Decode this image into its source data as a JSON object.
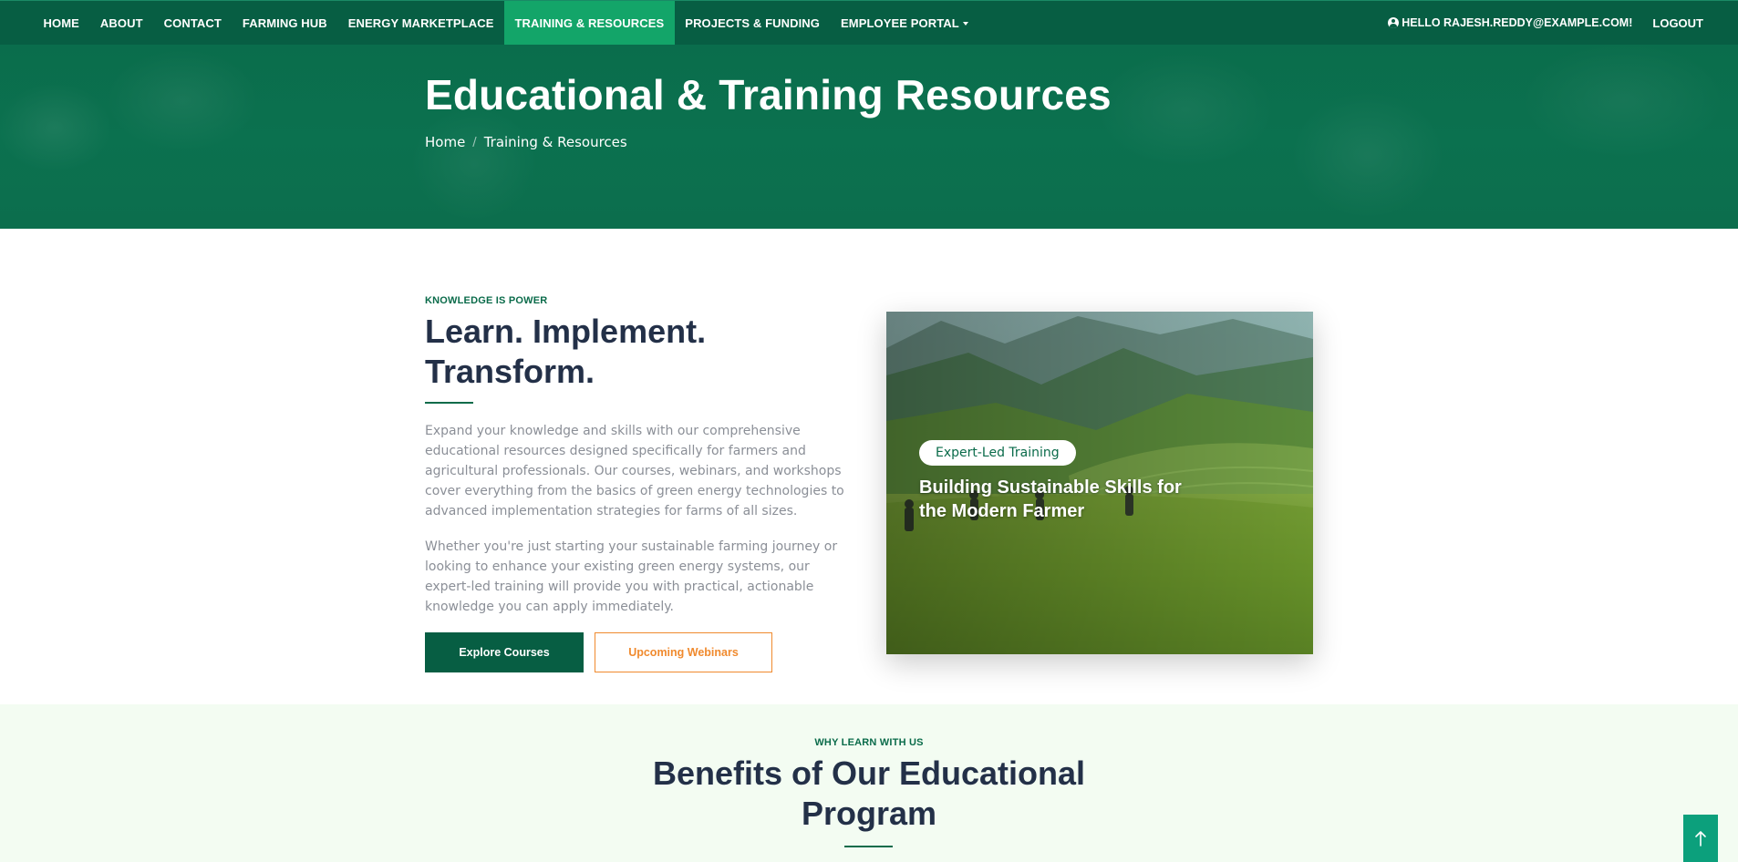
{
  "nav": {
    "items": [
      {
        "label": "HOME",
        "active": false
      },
      {
        "label": "ABOUT",
        "active": false
      },
      {
        "label": "CONTACT",
        "active": false
      },
      {
        "label": "FARMING HUB",
        "active": false
      },
      {
        "label": "ENERGY MARKETPLACE",
        "active": false
      },
      {
        "label": "TRAINING & RESOURCES",
        "active": true
      },
      {
        "label": "PROJECTS & FUNDING",
        "active": false
      },
      {
        "label": "EMPLOYEE PORTAL",
        "active": false,
        "dropdown": true
      }
    ],
    "user_greeting": "HELLO RAJESH.REDDY@EXAMPLE.COM!",
    "user_icon": "user-circle-icon",
    "logout_label": "LOGOUT"
  },
  "hero": {
    "title": "Educational & Training Resources",
    "breadcrumb": [
      "Home",
      "Training & Resources"
    ]
  },
  "intro": {
    "eyebrow": "KNOWLEDGE IS POWER",
    "heading": "Learn. Implement. Transform.",
    "paragraphs": [
      "Expand your knowledge and skills with our comprehensive educational resources designed specifically for farmers and agricultural professionals. Our courses, webinars, and workshops cover everything from the basics of green energy technologies to advanced implementation strategies for farms of all sizes.",
      "Whether you're just starting your sustainable farming journey or looking to enhance your existing green energy systems, our expert-led training will provide you with practical, actionable knowledge you can apply immediately."
    ],
    "primary_button": "Explore Courses",
    "secondary_button": "Upcoming Webinars"
  },
  "image_card": {
    "badge": "Expert-Led Training",
    "title": "Building Sustainable Skills for the Modern Farmer"
  },
  "benefits": {
    "eyebrow": "WHY LEARN WITH US",
    "title": "Benefits of Our Educational Program"
  },
  "back_to_top_icon": "arrow-up-icon",
  "colors": {
    "primary": "#075e43",
    "active_nav": "#13a569",
    "accent_orange": "#f08a2e",
    "benefits_bg": "#f3fcf2",
    "back_to_top": "#0ca07c"
  }
}
